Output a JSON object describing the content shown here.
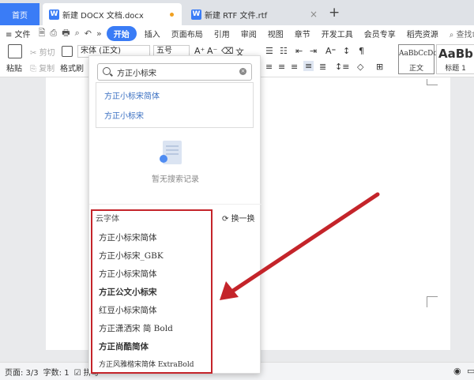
{
  "tabs": {
    "home": "首页",
    "docx": "新建 DOCX 文档.docx",
    "rtf": "新建 RTF 文件.rtf",
    "plus": "+",
    "close": "×"
  },
  "menubar": {
    "file": "≡ 文件",
    "more": "»",
    "items": [
      "开始",
      "插入",
      "页面布局",
      "引用",
      "审阅",
      "视图",
      "章节",
      "开发工具",
      "会员专享",
      "稻壳资源"
    ],
    "search": "查找命令"
  },
  "ribbon": {
    "paste": "粘贴",
    "cut": "剪切",
    "copy": "复制",
    "format_painter": "格式刷",
    "font_name": "宋体 (正文)",
    "font_size": "五号",
    "style_normal_preview": "AaBbCcDd",
    "style_normal": "正文",
    "style_h1_preview": "AaBb",
    "style_h1": "标题 1"
  },
  "dropdown": {
    "search_value": "方正小标宋",
    "suggestions": [
      "方正小标宋简体",
      "方正小标宋"
    ],
    "empty_text": "暂无搜索记录",
    "cloud_label": "云字体",
    "refresh": "换一换",
    "cloud_fonts": [
      "方正小标宋简体",
      "方正小标宋_GBK",
      "方正小标宋简体",
      "方正公文小标宋",
      "红豆小标宋简体",
      "方正潇洒宋 简 Bold",
      "方正尚酷简体",
      "方正风雅楷宋简体 ExtraBold"
    ]
  },
  "status": {
    "page": "页面: 3/3",
    "words": "字数: 1",
    "spell": "☑ 拼写"
  },
  "colors": {
    "accent": "#3a7cf6",
    "highlight": "#c4242a"
  },
  "icons": [
    "home-tab",
    "doc-icon",
    "search-icon",
    "clear-icon",
    "refresh-icon",
    "empty-record-icon",
    "eye-icon"
  ]
}
